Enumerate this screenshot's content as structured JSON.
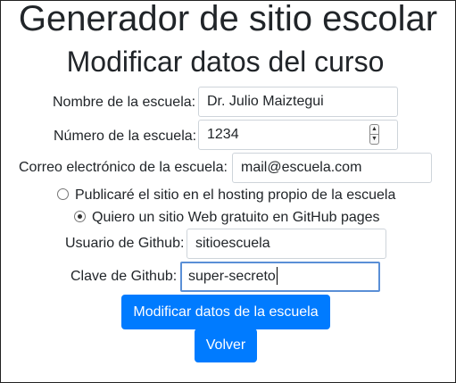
{
  "header": {
    "app_title": "Generador de sitio escolar",
    "page_title": "Modificar datos del curso"
  },
  "form": {
    "school_name": {
      "label": "Nombre de la escuela:",
      "value": "Dr. Julio Maiztegui"
    },
    "school_number": {
      "label": "Número de la escuela:",
      "value": "1234"
    },
    "school_email": {
      "label": "Correo electrónico de la escuela:",
      "value": "mail@escuela.com"
    },
    "hosting_options": [
      {
        "label": "Publicaré el sitio en el hosting propio de la escuela",
        "selected": false
      },
      {
        "label": "Quiero un sitio Web gratuito en GitHub pages",
        "selected": true
      }
    ],
    "github_user": {
      "label": "Usuario de Github:",
      "value": "sitioescuela"
    },
    "github_password": {
      "label": "Clave de Github:",
      "value": "super-secreto"
    }
  },
  "buttons": {
    "submit_label": "Modificar datos de la escuela",
    "back_label": "Volver"
  },
  "colors": {
    "primary": "#007bff",
    "focus_border": "#5a8fd6",
    "input_border": "#ced4da"
  }
}
